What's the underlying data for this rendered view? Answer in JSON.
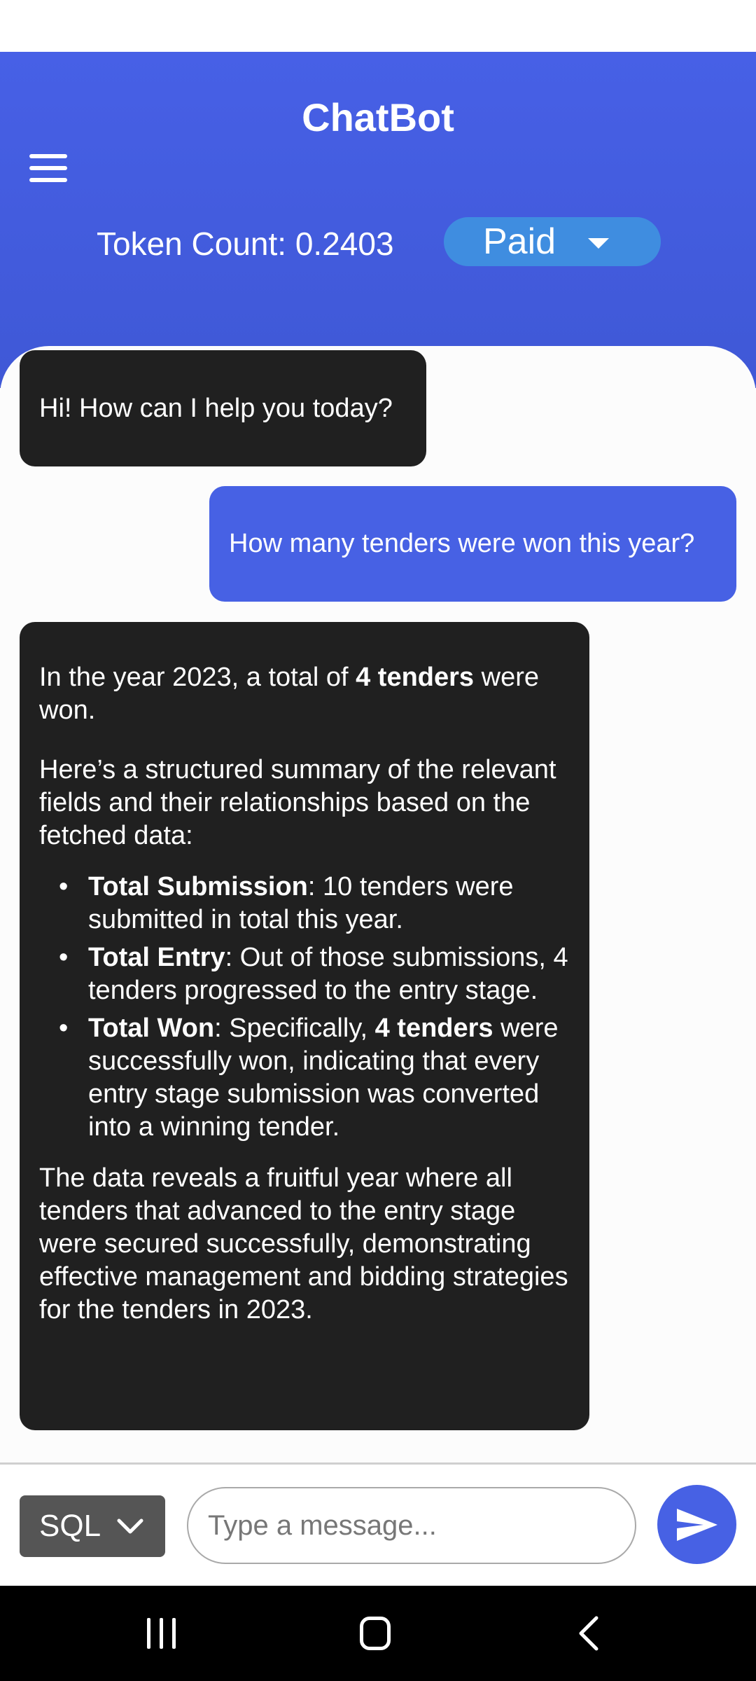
{
  "header": {
    "title": "ChatBot",
    "token_count": "Token Count: 0.2403",
    "plan_value": "Paid",
    "menu_icon": "hamburger-menu-icon",
    "colors": {
      "header": "#4760e6",
      "plan_select": "#3f8de0"
    }
  },
  "messages": {
    "greeting": "Hi! How can I help you today?",
    "user_question": "How many tenders were won this year?",
    "answer": {
      "p1_pre": "In the year 2023, a total of ",
      "p1_bold": "4 tenders",
      "p1_post": " were won.",
      "p2": "Here’s a structured summary of the relevant fields and their relationships based on the fetched data:",
      "bullet_char": "•",
      "bullets": [
        {
          "label": "Total Submission",
          "text": ": 10 tenders were submitted in total this year."
        },
        {
          "label": "Total Entry",
          "text": ": Out of those submissions, 4 tenders progressed to the entry stage."
        },
        {
          "label": "Total Won",
          "text_pre": ": Specifically, ",
          "bold": "4 tenders",
          "text_post": " were successfully won, indicating that every entry stage submission was converted into a winning tender."
        }
      ],
      "p3": "The data reveals a fruitful year where all tenders that advanced to the entry stage were secured successfully, demonstrating effective management and bidding strategies for the tenders in 2023."
    },
    "colors": {
      "bot_bubble": "#202020",
      "user_bubble": "#4761e4"
    }
  },
  "composer": {
    "mode_value": "SQL",
    "placeholder": "Type a message...",
    "send_icon": "send-icon"
  },
  "nav_bar": {
    "icons": [
      "recent-apps-icon",
      "home-icon",
      "back-icon"
    ]
  }
}
